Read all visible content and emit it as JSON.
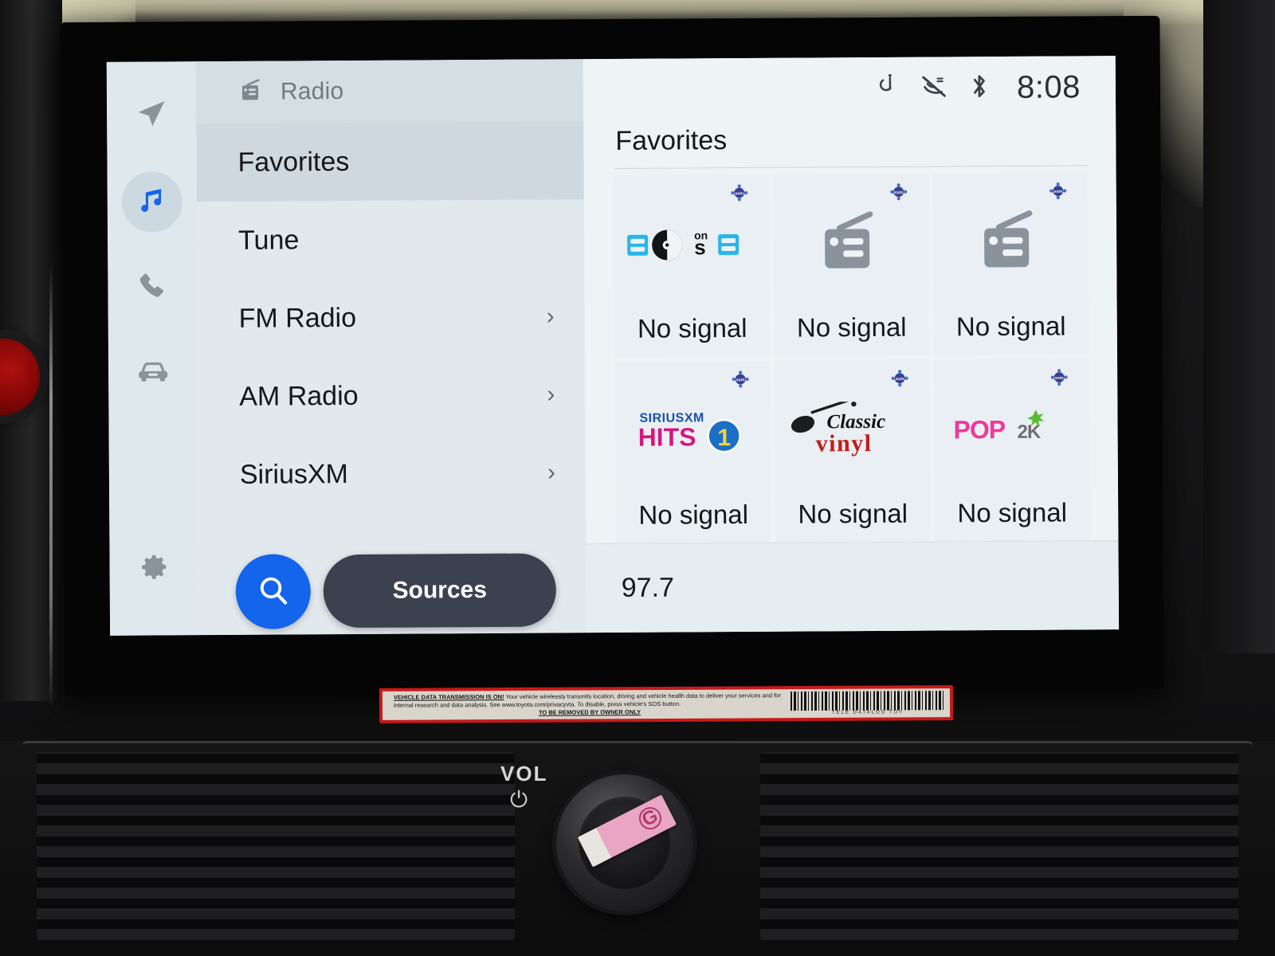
{
  "device": {
    "kind": "car-infotainment-head-unit"
  },
  "statusbar": {
    "icons": [
      "qi-wireless-charging-icon",
      "voice-recognition-muted-icon",
      "bluetooth-icon"
    ],
    "clock": "8:08"
  },
  "rail": {
    "items": [
      {
        "name": "navigation",
        "icon": "navigation-arrow-icon",
        "active": false
      },
      {
        "name": "media",
        "icon": "music-note-icon",
        "active": true
      },
      {
        "name": "phone",
        "icon": "phone-icon",
        "active": false
      },
      {
        "name": "vehicle",
        "icon": "car-icon",
        "active": false
      },
      {
        "name": "settings",
        "icon": "gear-icon",
        "active": false
      }
    ],
    "active_color": "#1464ec",
    "active_bg": "#ccd9e1"
  },
  "menu": {
    "header": {
      "icon": "radio-icon",
      "label": "Radio"
    },
    "items": [
      {
        "label": "Favorites",
        "chevron": "",
        "selected": true
      },
      {
        "label": "Tune",
        "chevron": "",
        "selected": false
      },
      {
        "label": "FM Radio",
        "chevron": "›",
        "selected": false
      },
      {
        "label": "AM Radio",
        "chevron": "›",
        "selected": false
      },
      {
        "label": "SiriusXM",
        "chevron": "›",
        "selected": false
      }
    ],
    "search_button": {
      "icon": "search-icon",
      "color": "#1464ec"
    },
    "sources_button": {
      "label": "Sources",
      "color": "#3c4150"
    }
  },
  "content": {
    "title": "Favorites",
    "tiles": [
      {
        "logo": "80s-on-8-logo",
        "label": "No signal",
        "badge": "siriusxm-badge-icon"
      },
      {
        "logo": "generic-radio-icon",
        "label": "No signal",
        "badge": "siriusxm-badge-icon"
      },
      {
        "logo": "generic-radio-icon",
        "label": "No signal",
        "badge": "siriusxm-badge-icon"
      },
      {
        "logo": "siriusxm-hits-1-logo",
        "label": "No signal",
        "badge": "siriusxm-badge-icon"
      },
      {
        "logo": "classic-vinyl-logo",
        "label": "No signal",
        "badge": "siriusxm-badge-icon"
      },
      {
        "logo": "pop2k-logo",
        "label": "No signal",
        "badge": "siriusxm-badge-icon"
      }
    ],
    "logo_text": {
      "eighties": {
        "d1": "8",
        "zero": "0",
        "s": "s",
        "on": "on",
        "d2": "8"
      },
      "hits1": {
        "brand": "SIRIUSXM",
        "word": "HITS",
        "number": "1"
      },
      "classic_vinyl": {
        "top": "Classic",
        "bottom": "vinyl"
      },
      "pop2k": {
        "main": "POP",
        "sub": "2K"
      }
    }
  },
  "nowplaying": {
    "frequency": "97.7"
  },
  "dash": {
    "volume_knob": {
      "label": "VOL",
      "power_glyph": "⏻"
    },
    "sticker": {
      "headline": "VEHICLE DATA TRANSMISSION IS ON!",
      "body": "Your vehicle wirelessly transmits location, driving and vehicle health data to deliver your services and for internal research and data analysis. See www.toyota.com/privacyvta. To disable, press vehicle's SOS button.",
      "footer": "TO BE REMOVED BY OWNER ONLY",
      "barcode_caption": "TELE   DATALOG   TOY"
    }
  }
}
